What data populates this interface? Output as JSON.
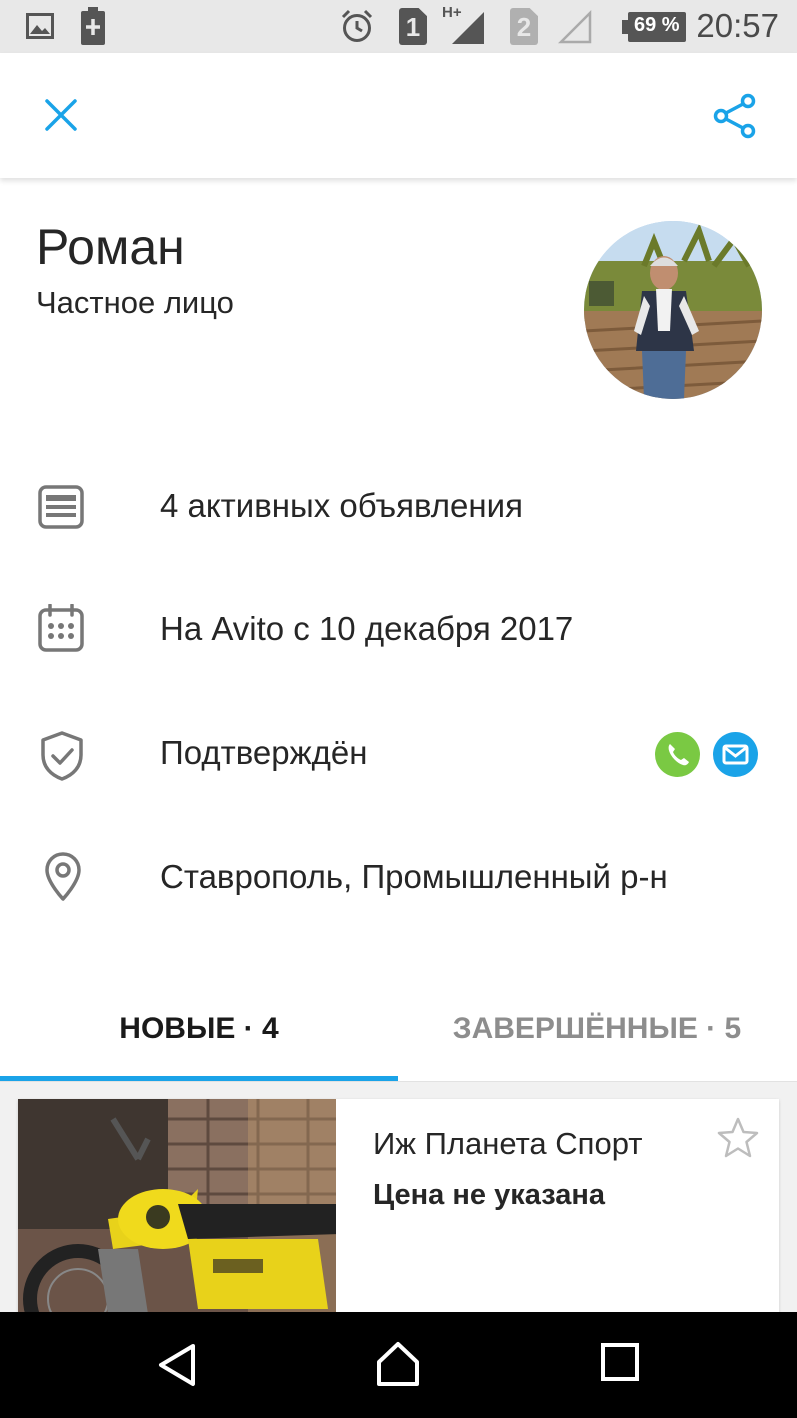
{
  "status_bar": {
    "time": "20:57",
    "battery": "69 %",
    "sim1": "1",
    "sim2": "2",
    "network": "H+",
    "icons": [
      "gallery-icon",
      "battery-saver-icon",
      "alarm-icon",
      "sim1-icon",
      "signal-icon",
      "sim2-icon",
      "no-signal-icon",
      "battery-icon"
    ]
  },
  "toolbar": {
    "close_icon": "close-icon",
    "share_icon": "share-icon",
    "accent_color": "#1aa3e8"
  },
  "profile": {
    "name": "Роман",
    "type": "Частное лицо",
    "avatar": "avatar"
  },
  "info": {
    "ads": "4 активных объявления",
    "since": "На Avito с 10 декабря 2017",
    "verified": "Подтверждён",
    "location": "Ставрополь, Промышленный р-н",
    "phone_badge_color": "#7ac943",
    "email_badge_color": "#1aa3e8"
  },
  "tabs": {
    "active": "НОВЫЕ · 4",
    "inactive": "ЗАВЕРШЁННЫЕ · 5"
  },
  "listing": {
    "title": "Иж Планета Спорт",
    "price": "Цена не указана",
    "fav_icon": "star-icon"
  },
  "navbar": {
    "icons": [
      "back-icon",
      "home-icon",
      "recents-icon"
    ]
  }
}
